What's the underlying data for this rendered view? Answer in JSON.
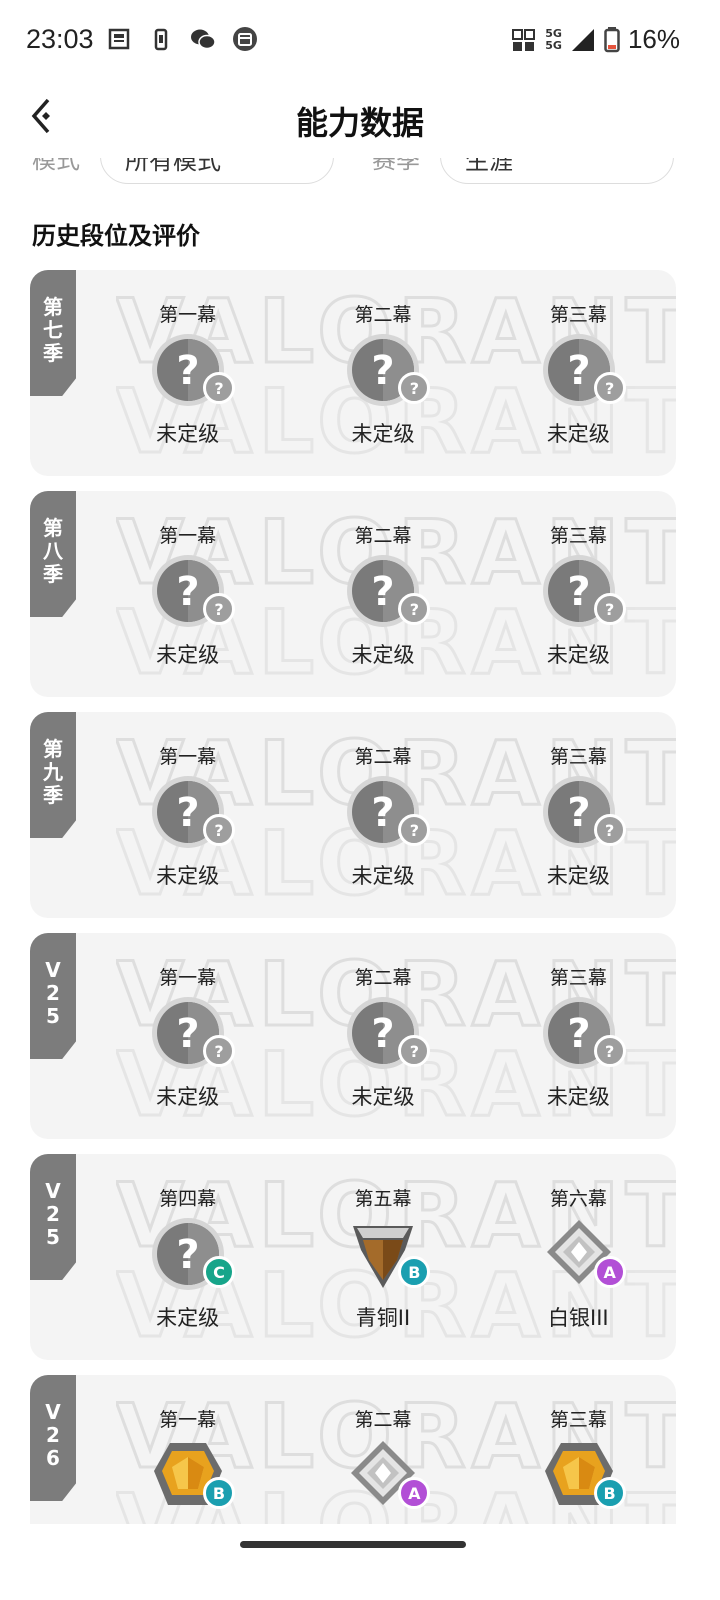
{
  "status_bar": {
    "time": "23:03",
    "network": "5G 5G",
    "battery": "16%",
    "battery_color": "#e5533d"
  },
  "header": {
    "title": "能力数据"
  },
  "filters": {
    "mode_label": "模式",
    "mode_value": "所有模式",
    "season_label": "赛季",
    "season_value": "生涯"
  },
  "section_title": "历史段位及评价",
  "colors": {
    "card_bg": "#f4f4f4",
    "tag_bg": "#7c7c7c",
    "badge_unknown": "#9e9e9e",
    "badge_A": "#b24fd6",
    "badge_B": "#1a9fb0",
    "badge_C": "#17a58a"
  },
  "seasons": [
    {
      "tag": "第七季",
      "acts": [
        {
          "label": "第一幕",
          "rank": "未定级",
          "icon": "unranked-icon",
          "grade": "?"
        },
        {
          "label": "第二幕",
          "rank": "未定级",
          "icon": "unranked-icon",
          "grade": "?"
        },
        {
          "label": "第三幕",
          "rank": "未定级",
          "icon": "unranked-icon",
          "grade": "?"
        }
      ]
    },
    {
      "tag": "第八季",
      "acts": [
        {
          "label": "第一幕",
          "rank": "未定级",
          "icon": "unranked-icon",
          "grade": "?"
        },
        {
          "label": "第二幕",
          "rank": "未定级",
          "icon": "unranked-icon",
          "grade": "?"
        },
        {
          "label": "第三幕",
          "rank": "未定级",
          "icon": "unranked-icon",
          "grade": "?"
        }
      ]
    },
    {
      "tag": "第九季",
      "acts": [
        {
          "label": "第一幕",
          "rank": "未定级",
          "icon": "unranked-icon",
          "grade": "?"
        },
        {
          "label": "第二幕",
          "rank": "未定级",
          "icon": "unranked-icon",
          "grade": "?"
        },
        {
          "label": "第三幕",
          "rank": "未定级",
          "icon": "unranked-icon",
          "grade": "?"
        }
      ]
    },
    {
      "tag": "V25",
      "acts": [
        {
          "label": "第一幕",
          "rank": "未定级",
          "icon": "unranked-icon",
          "grade": "?"
        },
        {
          "label": "第二幕",
          "rank": "未定级",
          "icon": "unranked-icon",
          "grade": "?"
        },
        {
          "label": "第三幕",
          "rank": "未定级",
          "icon": "unranked-icon",
          "grade": "?"
        }
      ]
    },
    {
      "tag": "V25",
      "acts": [
        {
          "label": "第四幕",
          "rank": "未定级",
          "icon": "unranked-icon",
          "grade": "C"
        },
        {
          "label": "第五幕",
          "rank": "青铜II",
          "icon": "bronze-rank-icon",
          "grade": "B"
        },
        {
          "label": "第六幕",
          "rank": "白银III",
          "icon": "silver-rank-icon",
          "grade": "A"
        }
      ]
    },
    {
      "tag": "V26",
      "acts": [
        {
          "label": "第一幕",
          "rank": "",
          "icon": "gold-rank-icon",
          "grade": "B"
        },
        {
          "label": "第二幕",
          "rank": "",
          "icon": "silver-rank-icon",
          "grade": "A"
        },
        {
          "label": "第三幕",
          "rank": "",
          "icon": "gold-rank-icon",
          "grade": "B"
        }
      ]
    }
  ]
}
